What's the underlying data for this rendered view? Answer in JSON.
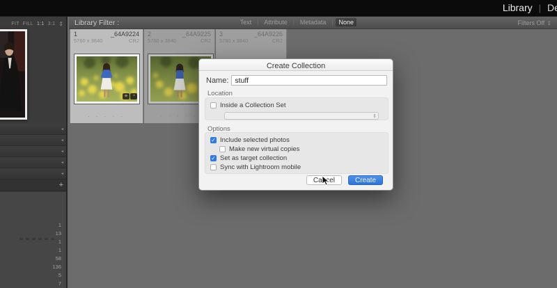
{
  "top_bar": {
    "module_active": "Library",
    "module_separator": "|",
    "module_next": "Develop"
  },
  "navigator": {
    "zoom_labels": [
      "FIT",
      "FILL",
      "1:1",
      "3:1"
    ],
    "zoom_menu_glyph": "⇕",
    "panel_arrow_glyph": "◂",
    "add_button_glyph": "+"
  },
  "filter_bar": {
    "title": "Library Filter :",
    "modes": [
      {
        "label": "Text"
      },
      {
        "label": "Attribute"
      },
      {
        "label": "Metadata"
      },
      {
        "label": "None"
      }
    ],
    "mode_separator": "|",
    "preset": "Filters Off",
    "preset_disclosure": "⇕"
  },
  "grid": {
    "rating_dots": ". . . . .",
    "badge_glyphs": {
      "crop": "⌯",
      "adjust": "◔"
    },
    "cells": [
      {
        "index": "1",
        "filename": "_64A9224",
        "dimensions": "5760 x 3840",
        "format": "CR2",
        "selected": true
      },
      {
        "index": "2",
        "filename": "_64A9225",
        "dimensions": "5760 x 3840",
        "format": "CR2",
        "selected": false
      },
      {
        "index": "3",
        "filename": "_64A9226",
        "dimensions": "5760 x 3840",
        "format": "CR2",
        "selected": false
      }
    ]
  },
  "sidebar": {
    "collection_counts": [
      "1",
      "13",
      "1",
      "1",
      "58",
      "136",
      "5",
      "7"
    ]
  },
  "dialog": {
    "title": "Create Collection",
    "name_label": "Name:",
    "name_value": "stuff",
    "location_label": "Location",
    "location_checkbox": {
      "label": "Inside a Collection Set",
      "checked": false
    },
    "options_label": "Options",
    "check_glyph": "✓",
    "options": [
      {
        "label": "Include selected photos",
        "checked": true
      },
      {
        "label": "Make new virtual copies",
        "checked": false
      },
      {
        "label": "Set as target collection",
        "checked": true
      },
      {
        "label": "Sync with Lightroom mobile",
        "checked": false
      }
    ],
    "cancel_label": "Cancel",
    "create_label": "Create"
  },
  "colors": {
    "accent_blue": "#2f74d5",
    "checkbox_blue": "#2f7ae5",
    "selected_cell_bg": "#bdbdbd",
    "cell_bg": "#9e9e9e",
    "main_bg": "#6c6c6c",
    "sidebar_bg": "#3b3b3b",
    "top_bar_bg": "#0b0b0b",
    "dialog_bg": "#f2f2f2"
  }
}
